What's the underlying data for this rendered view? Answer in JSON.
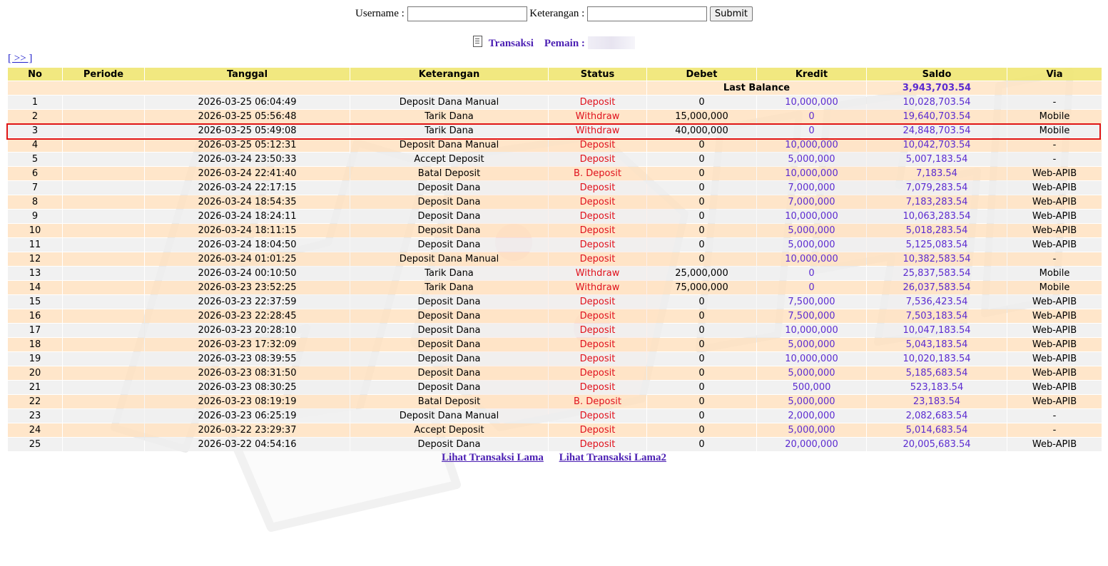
{
  "form": {
    "username_label": "Username :",
    "username_value": "",
    "keterangan_label": "Keterangan :",
    "keterangan_value": "",
    "submit_label": "Submit"
  },
  "title": {
    "transaksi": "Transaksi",
    "pemain_label": "Pemain :"
  },
  "nav_next": "[ >> ]",
  "columns": [
    "No",
    "Periode",
    "Tanggal",
    "Keterangan",
    "Status",
    "Debet",
    "Kredit",
    "Saldo",
    "Via"
  ],
  "last_balance": {
    "label": "Last Balance",
    "value": "3,943,703.54"
  },
  "rows": [
    {
      "no": "1",
      "periode": "",
      "tanggal": "2026-03-25 06:04:49",
      "keterangan": "Deposit Dana Manual",
      "status": "Deposit",
      "debet": "0",
      "kredit": "10,000,000",
      "saldo": "10,028,703.54",
      "via": "-"
    },
    {
      "no": "2",
      "periode": "",
      "tanggal": "2026-03-25 05:56:48",
      "keterangan": "Tarik Dana",
      "status": "Withdraw",
      "debet": "15,000,000",
      "kredit": "0",
      "saldo": "19,640,703.54",
      "via": "Mobile"
    },
    {
      "no": "3",
      "periode": "",
      "tanggal": "2026-03-25 05:49:08",
      "keterangan": "Tarik Dana",
      "status": "Withdraw",
      "debet": "40,000,000",
      "kredit": "0",
      "saldo": "24,848,703.54",
      "via": "Mobile"
    },
    {
      "no": "4",
      "periode": "",
      "tanggal": "2026-03-25 05:12:31",
      "keterangan": "Deposit Dana Manual",
      "status": "Deposit",
      "debet": "0",
      "kredit": "10,000,000",
      "saldo": "10,042,703.54",
      "via": "-"
    },
    {
      "no": "5",
      "periode": "",
      "tanggal": "2026-03-24 23:50:33",
      "keterangan": "Accept Deposit",
      "status": "Deposit",
      "debet": "0",
      "kredit": "5,000,000",
      "saldo": "5,007,183.54",
      "via": "-"
    },
    {
      "no": "6",
      "periode": "",
      "tanggal": "2026-03-24 22:41:40",
      "keterangan": "Batal Deposit",
      "status": "B. Deposit",
      "debet": "0",
      "kredit": "10,000,000",
      "saldo": "7,183.54",
      "via": "Web-APIB"
    },
    {
      "no": "7",
      "periode": "",
      "tanggal": "2026-03-24 22:17:15",
      "keterangan": "Deposit Dana",
      "status": "Deposit",
      "debet": "0",
      "kredit": "7,000,000",
      "saldo": "7,079,283.54",
      "via": "Web-APIB"
    },
    {
      "no": "8",
      "periode": "",
      "tanggal": "2026-03-24 18:54:35",
      "keterangan": "Deposit Dana",
      "status": "Deposit",
      "debet": "0",
      "kredit": "7,000,000",
      "saldo": "7,183,283.54",
      "via": "Web-APIB"
    },
    {
      "no": "9",
      "periode": "",
      "tanggal": "2026-03-24 18:24:11",
      "keterangan": "Deposit Dana",
      "status": "Deposit",
      "debet": "0",
      "kredit": "10,000,000",
      "saldo": "10,063,283.54",
      "via": "Web-APIB"
    },
    {
      "no": "10",
      "periode": "",
      "tanggal": "2026-03-24 18:11:15",
      "keterangan": "Deposit Dana",
      "status": "Deposit",
      "debet": "0",
      "kredit": "5,000,000",
      "saldo": "5,018,283.54",
      "via": "Web-APIB"
    },
    {
      "no": "11",
      "periode": "",
      "tanggal": "2026-03-24 18:04:50",
      "keterangan": "Deposit Dana",
      "status": "Deposit",
      "debet": "0",
      "kredit": "5,000,000",
      "saldo": "5,125,083.54",
      "via": "Web-APIB"
    },
    {
      "no": "12",
      "periode": "",
      "tanggal": "2026-03-24 01:01:25",
      "keterangan": "Deposit Dana Manual",
      "status": "Deposit",
      "debet": "0",
      "kredit": "10,000,000",
      "saldo": "10,382,583.54",
      "via": "-"
    },
    {
      "no": "13",
      "periode": "",
      "tanggal": "2026-03-24 00:10:50",
      "keterangan": "Tarik Dana",
      "status": "Withdraw",
      "debet": "25,000,000",
      "kredit": "0",
      "saldo": "25,837,583.54",
      "via": "Mobile"
    },
    {
      "no": "14",
      "periode": "",
      "tanggal": "2026-03-23 23:52:25",
      "keterangan": "Tarik Dana",
      "status": "Withdraw",
      "debet": "75,000,000",
      "kredit": "0",
      "saldo": "26,037,583.54",
      "via": "Mobile"
    },
    {
      "no": "15",
      "periode": "",
      "tanggal": "2026-03-23 22:37:59",
      "keterangan": "Deposit Dana",
      "status": "Deposit",
      "debet": "0",
      "kredit": "7,500,000",
      "saldo": "7,536,423.54",
      "via": "Web-APIB"
    },
    {
      "no": "16",
      "periode": "",
      "tanggal": "2026-03-23 22:28:45",
      "keterangan": "Deposit Dana",
      "status": "Deposit",
      "debet": "0",
      "kredit": "7,500,000",
      "saldo": "7,503,183.54",
      "via": "Web-APIB"
    },
    {
      "no": "17",
      "periode": "",
      "tanggal": "2026-03-23 20:28:10",
      "keterangan": "Deposit Dana",
      "status": "Deposit",
      "debet": "0",
      "kredit": "10,000,000",
      "saldo": "10,047,183.54",
      "via": "Web-APIB"
    },
    {
      "no": "18",
      "periode": "",
      "tanggal": "2026-03-23 17:32:09",
      "keterangan": "Deposit Dana",
      "status": "Deposit",
      "debet": "0",
      "kredit": "5,000,000",
      "saldo": "5,043,183.54",
      "via": "Web-APIB"
    },
    {
      "no": "19",
      "periode": "",
      "tanggal": "2026-03-23 08:39:55",
      "keterangan": "Deposit Dana",
      "status": "Deposit",
      "debet": "0",
      "kredit": "10,000,000",
      "saldo": "10,020,183.54",
      "via": "Web-APIB"
    },
    {
      "no": "20",
      "periode": "",
      "tanggal": "2026-03-23 08:31:50",
      "keterangan": "Deposit Dana",
      "status": "Deposit",
      "debet": "0",
      "kredit": "5,000,000",
      "saldo": "5,185,683.54",
      "via": "Web-APIB"
    },
    {
      "no": "21",
      "periode": "",
      "tanggal": "2026-03-23 08:30:25",
      "keterangan": "Deposit Dana",
      "status": "Deposit",
      "debet": "0",
      "kredit": "500,000",
      "saldo": "523,183.54",
      "via": "Web-APIB"
    },
    {
      "no": "22",
      "periode": "",
      "tanggal": "2026-03-23 08:19:19",
      "keterangan": "Batal Deposit",
      "status": "B. Deposit",
      "debet": "0",
      "kredit": "5,000,000",
      "saldo": "23,183.54",
      "via": "Web-APIB"
    },
    {
      "no": "23",
      "periode": "",
      "tanggal": "2026-03-23 06:25:19",
      "keterangan": "Deposit Dana Manual",
      "status": "Deposit",
      "debet": "0",
      "kredit": "2,000,000",
      "saldo": "2,082,683.54",
      "via": "-"
    },
    {
      "no": "24",
      "periode": "",
      "tanggal": "2026-03-22 23:29:37",
      "keterangan": "Accept Deposit",
      "status": "Deposit",
      "debet": "0",
      "kredit": "5,000,000",
      "saldo": "5,014,683.54",
      "via": "-"
    },
    {
      "no": "25",
      "periode": "",
      "tanggal": "2026-03-22 04:54:16",
      "keterangan": "Deposit Dana",
      "status": "Deposit",
      "debet": "0",
      "kredit": "20,000,000",
      "saldo": "20,005,683.54",
      "via": "Web-APIB"
    }
  ],
  "links": {
    "lama": "Lihat Transaksi Lama",
    "lama2": "Lihat Transaksi Lama2"
  },
  "colors": {
    "header_bg": "#f0e676",
    "row_even": "#ffe0be",
    "row_odd": "#eeeeee",
    "status_red": "#e0111c",
    "amount_purple": "#5b2bd0",
    "highlight_red": "#e01515"
  }
}
